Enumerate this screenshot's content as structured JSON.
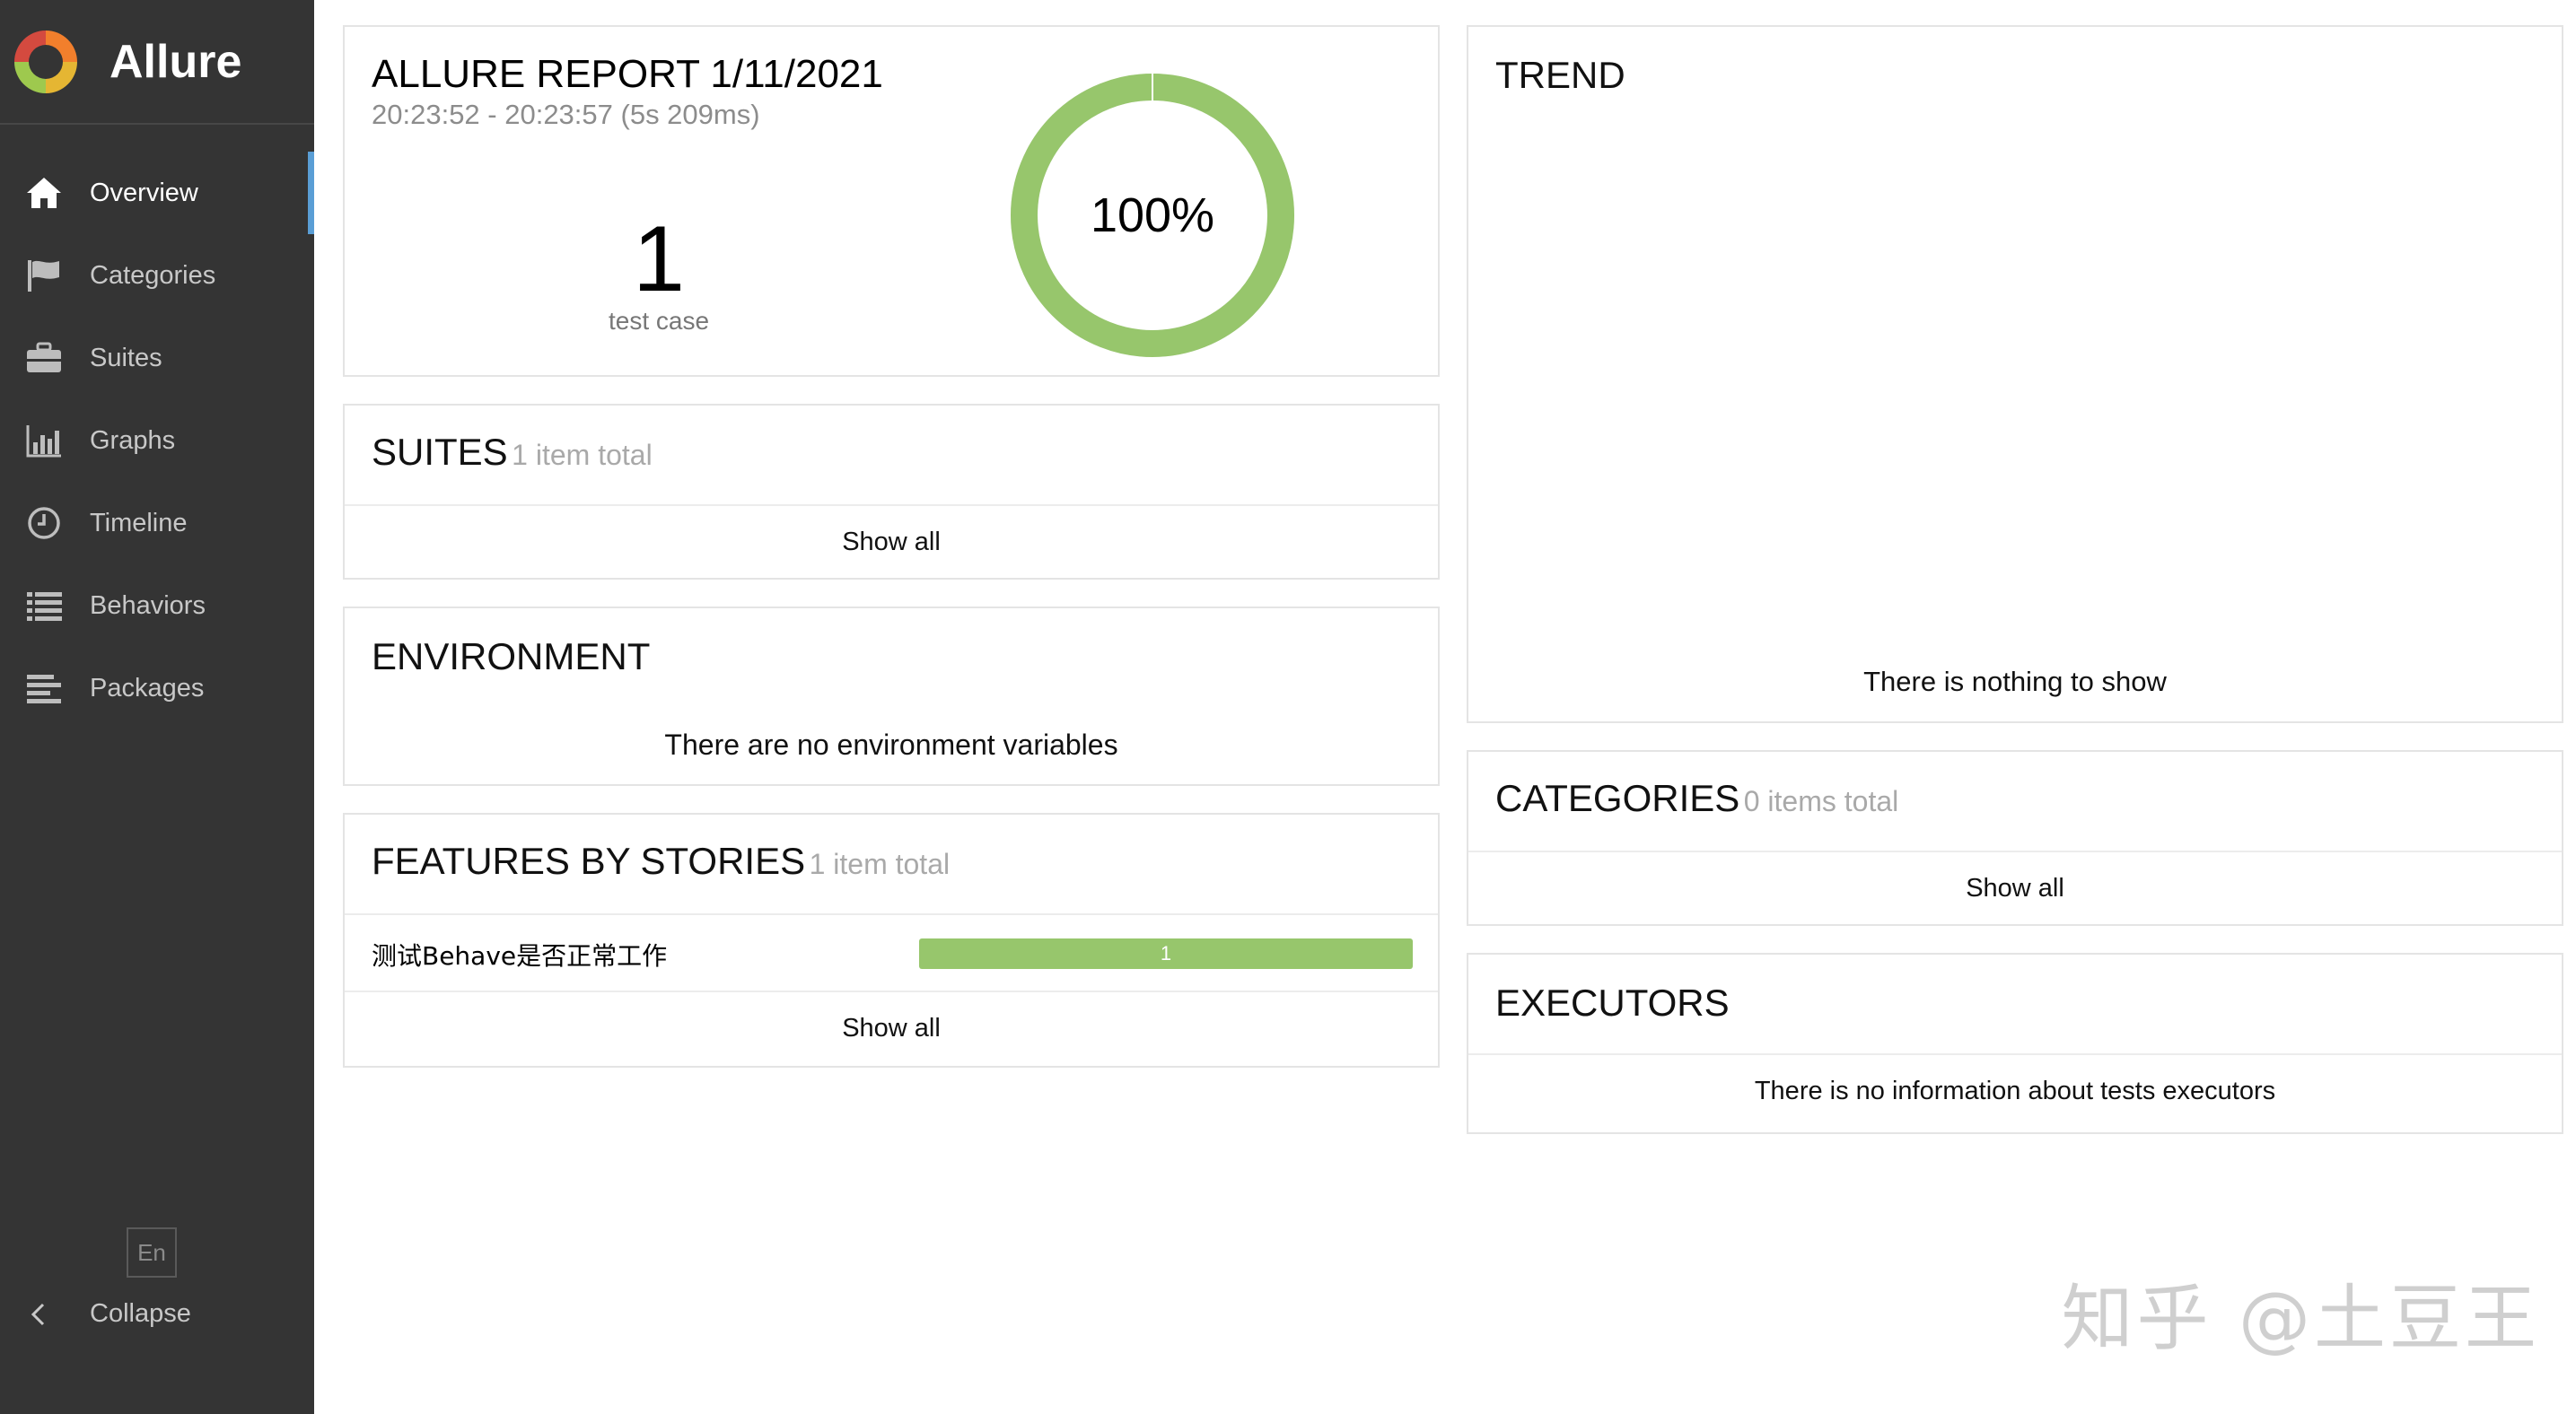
{
  "sidebar": {
    "brand": "Allure",
    "items": [
      {
        "label": "Overview",
        "icon": "home-icon"
      },
      {
        "label": "Categories",
        "icon": "flag-icon"
      },
      {
        "label": "Suites",
        "icon": "briefcase-icon"
      },
      {
        "label": "Graphs",
        "icon": "bar-chart-icon"
      },
      {
        "label": "Timeline",
        "icon": "clock-icon"
      },
      {
        "label": "Behaviors",
        "icon": "list-icon"
      },
      {
        "label": "Packages",
        "icon": "align-left-icon"
      }
    ],
    "language": "En",
    "collapse_label": "Collapse"
  },
  "summary": {
    "title": "ALLURE REPORT 1/11/2021",
    "time": "20:23:52 - 20:23:57 (5s 209ms)",
    "count": "1",
    "count_label": "test case",
    "percent_label": "100%",
    "passed_fraction": 1.0,
    "passed_color": "#97c66c"
  },
  "suites": {
    "title": "SUITES",
    "subtitle": "1 item total",
    "show_all": "Show all"
  },
  "environment": {
    "title": "ENVIRONMENT",
    "message": "There are no environment variables"
  },
  "features": {
    "title": "FEATURES BY STORIES",
    "subtitle": "1 item total",
    "rows": [
      {
        "name": "测试Behave是否正常工作",
        "passed": "1"
      }
    ],
    "show_all": "Show all"
  },
  "trend": {
    "title": "TREND",
    "message": "There is nothing to show"
  },
  "categories": {
    "title": "CATEGORIES",
    "subtitle": "0 items total",
    "show_all": "Show all"
  },
  "executors": {
    "title": "EXECUTORS",
    "message": "There is no information about tests executors"
  },
  "watermark": "知乎 @土豆王"
}
